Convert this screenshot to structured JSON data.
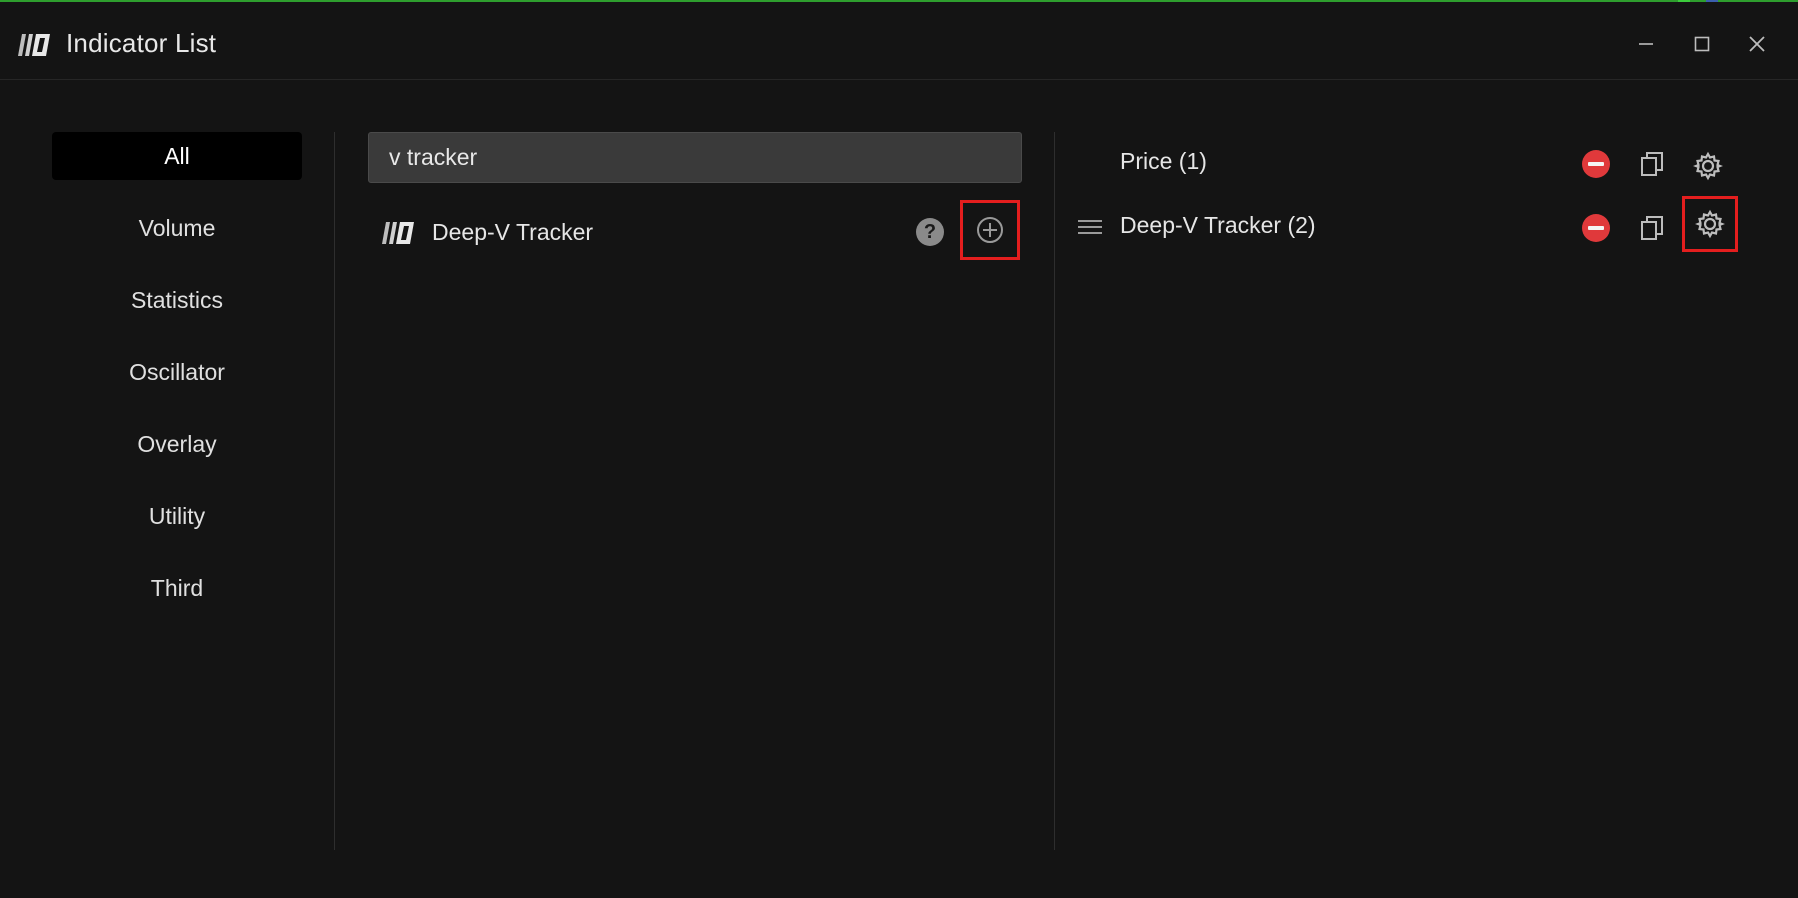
{
  "window": {
    "title": "Indicator List",
    "controls": {
      "minimize_icon": "minimize-icon",
      "maximize_icon": "maximize-icon",
      "close_icon": "close-icon"
    }
  },
  "categories": {
    "items": [
      {
        "label": "All",
        "active": true
      },
      {
        "label": "Volume",
        "active": false
      },
      {
        "label": "Statistics",
        "active": false
      },
      {
        "label": "Oscillator",
        "active": false
      },
      {
        "label": "Overlay",
        "active": false
      },
      {
        "label": "Utility",
        "active": false
      },
      {
        "label": "Third",
        "active": false
      }
    ]
  },
  "search": {
    "value": "v tracker",
    "placeholder": ""
  },
  "results": [
    {
      "name": "Deep-V Tracker",
      "icon": "brand-logo-icon",
      "help_icon": "help-icon",
      "add_icon": "add-circle-icon",
      "highlighted": true
    }
  ],
  "active_indicators": [
    {
      "label": "Price (1)",
      "draggable": false,
      "remove_icon": "remove-icon",
      "copy_icon": "copy-icon",
      "settings_icon": "gear-icon",
      "settings_highlighted": false
    },
    {
      "label": "Deep-V Tracker (2)",
      "draggable": true,
      "remove_icon": "remove-icon",
      "copy_icon": "copy-icon",
      "settings_icon": "gear-icon",
      "settings_highlighted": true
    }
  ],
  "colors": {
    "background": "#141414",
    "highlight_box": "#e41e1e",
    "remove_red": "#e0393b",
    "accent_green": "#2e9e2e"
  }
}
